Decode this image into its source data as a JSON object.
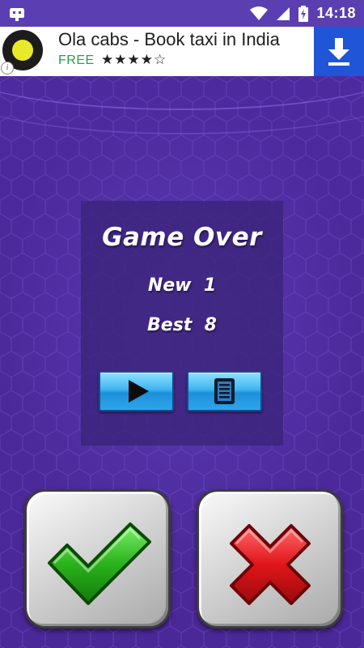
{
  "status_bar": {
    "time": "14:18",
    "icons": [
      "android-debug-icon",
      "wifi-icon",
      "signal-icon",
      "battery-charging-icon"
    ]
  },
  "ad": {
    "title": "Ola cabs - Book taxi in India",
    "price": "FREE",
    "rating_stars": "★★★★☆",
    "rating": 4,
    "info_glyph": "i",
    "icons": [
      "ola-logo-icon",
      "download-icon",
      "info-icon"
    ]
  },
  "game_over": {
    "title": "Game Over",
    "new_label": "New",
    "new_value": "1",
    "best_label": "Best",
    "best_value": "8"
  },
  "buttons": {
    "play": "play-icon",
    "menu": "list-icon",
    "confirm": "checkmark-icon",
    "cancel": "cross-icon"
  },
  "colors": {
    "background": "#4a2a9a",
    "panel_button": "#2ea6ea",
    "confirm": "#2bb31c",
    "cancel": "#e0151a"
  }
}
